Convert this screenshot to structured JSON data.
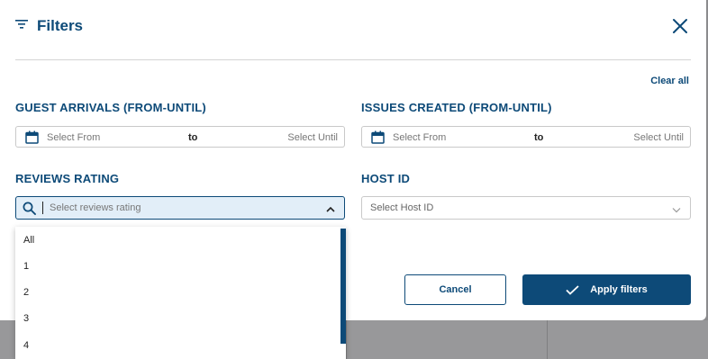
{
  "modal": {
    "title": "Filters",
    "clear_all": "Clear all"
  },
  "guest_arrivals": {
    "label": "GUEST ARRIVALS (FROM-UNTIL)",
    "from_placeholder": "Select From",
    "to": "to",
    "until_placeholder": "Select Until"
  },
  "issues_created": {
    "label": "ISSUES CREATED (FROM-UNTIL)",
    "from_placeholder": "Select From",
    "to": "to",
    "until_placeholder": "Select Until"
  },
  "reviews_rating": {
    "label": "REVIEWS RATING",
    "placeholder": "Select reviews rating",
    "options": [
      "All",
      "1",
      "2",
      "3",
      "4"
    ]
  },
  "host_id": {
    "label": "HOST ID",
    "placeholder": "Select Host ID"
  },
  "buttons": {
    "cancel": "Cancel",
    "apply": "Apply filters"
  },
  "colors": {
    "primary": "#0d4a78",
    "active_field_bg": "#e2eef8",
    "backdrop": "#8b8b8d"
  },
  "icons": {
    "title": "filter-icon",
    "close": "close-icon",
    "date": "calendar-icon",
    "search": "search-icon",
    "open": "chevron-up-icon",
    "closed": "chevron-down-icon",
    "apply": "check-icon"
  }
}
